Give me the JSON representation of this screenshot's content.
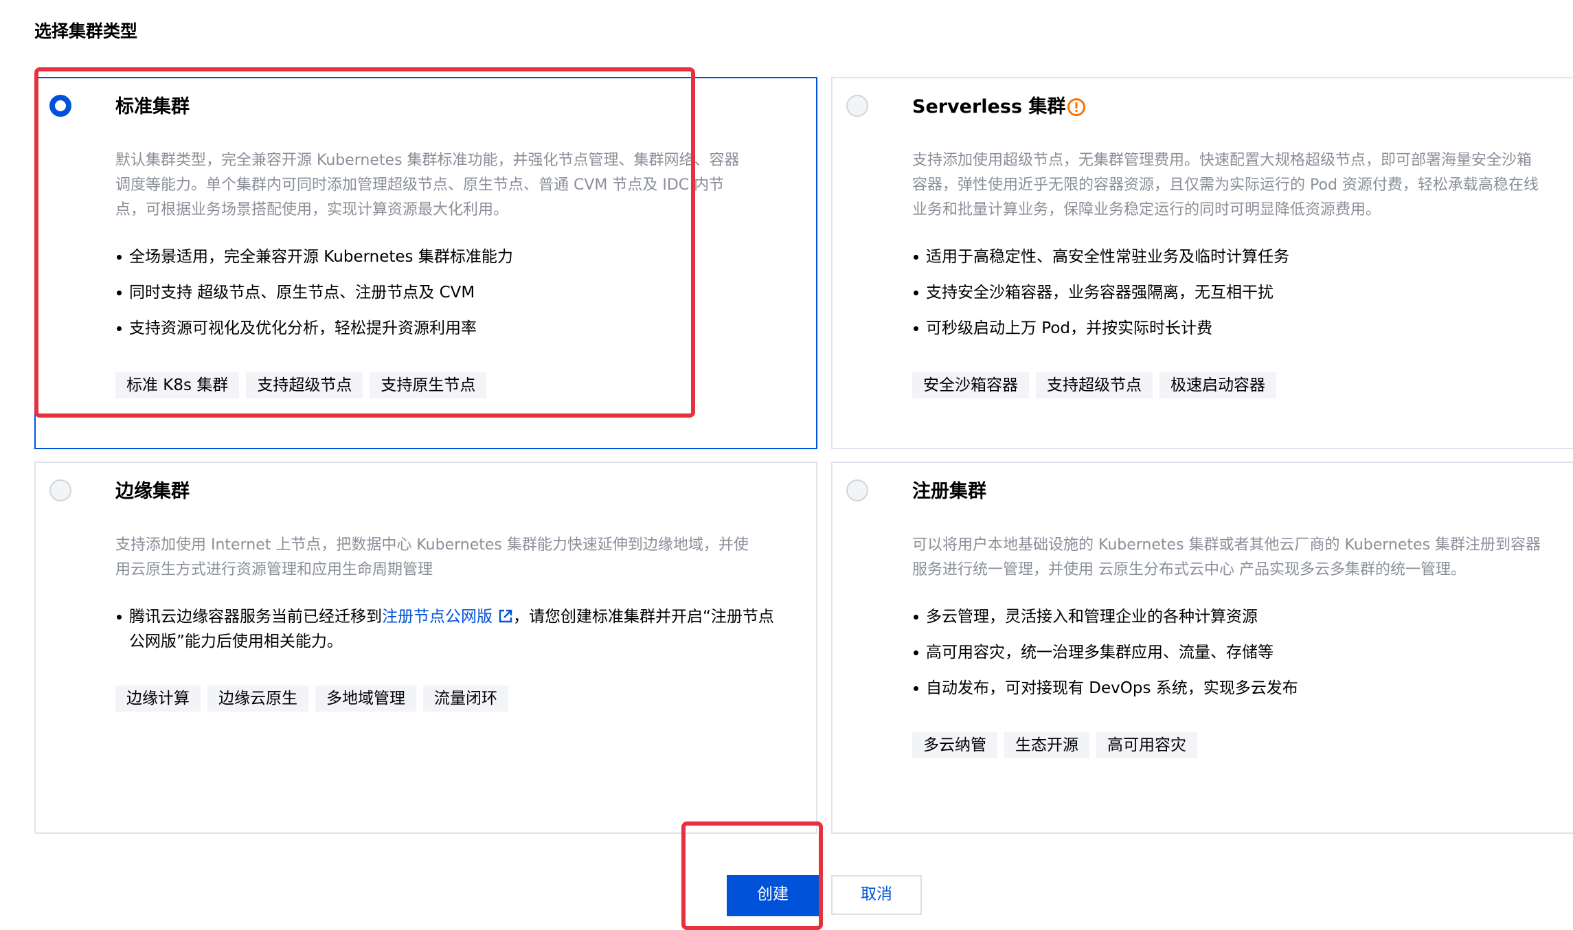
{
  "page": {
    "title": "选择集群类型"
  },
  "cards": {
    "standard": {
      "title": "标准集群",
      "description": [
        "默认集群类型，完全兼容开源 Kubernetes 集群标准功能，并强化节点管理、集群网络、容器",
        "调度等能力。单个集群内可同时添加管理超级节点、原生节点、普通 CVM 节点及 IDC 内节",
        "点，可根据业务场景搭配使用，实现计算资源最大化利用。"
      ],
      "features": [
        "全场景适用，完全兼容开源 Kubernetes 集群标准能力",
        "同时支持 超级节点、原生节点、注册节点及 CVM",
        "支持资源可视化及优化分析，轻松提升资源利用率"
      ],
      "tags": [
        "标准 K8s 集群",
        "支持超级节点",
        "支持原生节点"
      ],
      "selected": true
    },
    "serverless": {
      "title": "Serverless 集群",
      "icon": "warning-icon",
      "description": [
        "支持添加使用超级节点，无集群管理费用。快速配置大规格超级节点，即可部署海量安全沙箱",
        "容器，弹性使用近乎无限的容器资源，且仅需为实际运行的 Pod 资源付费，轻松承载高稳在线",
        "业务和批量计算业务，保障业务稳定运行的同时可明显降低资源费用。"
      ],
      "features": [
        "适用于高稳定性、高安全性常驻业务及临时计算任务",
        "支持安全沙箱容器，业务容器强隔离，无互相干扰",
        "可秒级启动上万 Pod，并按实际时长计费"
      ],
      "tags": [
        "安全沙箱容器",
        "支持超级节点",
        "极速启动容器"
      ],
      "selected": false
    },
    "edge": {
      "title": "边缘集群",
      "description": [
        "支持添加使用 Internet 上节点，把数据中心 Kubernetes 集群能力快速延伸到边缘地域，并使",
        "用云原生方式进行资源管理和应用生命周期管理"
      ],
      "feature_prefix": "腾讯云边缘容器服务当前已经迁移到",
      "feature_link": "注册节点公网版",
      "feature_suffix": "，请您创建标准集群并开启“注册节点",
      "feature_line2": "公网版”能力后使用相关能力。",
      "tags": [
        "边缘计算",
        "边缘云原生",
        "多地域管理",
        "流量闭环"
      ],
      "selected": false
    },
    "registered": {
      "title": "注册集群",
      "description": [
        "可以将用户本地基础设施的 Kubernetes 集群或者其他云厂商的 Kubernetes 集群注册到容器",
        "服务进行统一管理，并使用 云原生分布式云中心 产品实现多云多集群的统一管理。"
      ],
      "features": [
        "多云管理，灵活接入和管理企业的各种计算资源",
        "高可用容灾，统一治理多集群应用、流量、存储等",
        "自动发布，可对接现有 DevOps 系统，实现多云发布"
      ],
      "tags": [
        "多云纳管",
        "生态开源",
        "高可用容灾"
      ],
      "selected": false
    }
  },
  "actions": {
    "create_label": "创建",
    "cancel_label": "取消"
  },
  "colors": {
    "primary": "#0052d9",
    "highlight": "#e5323e",
    "warning": "#ff7200",
    "muted_text": "#8a8f99",
    "tag_bg": "#f3f4f7"
  }
}
